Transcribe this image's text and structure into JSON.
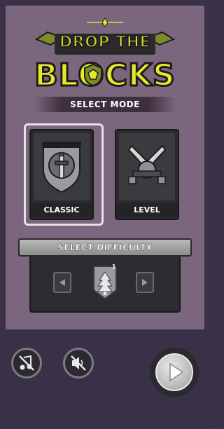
{
  "logo": {
    "line1": "DROP THE",
    "line2": "BLOCKS",
    "colors": {
      "text": "#e4e92b",
      "shield": "#7c8b2a",
      "outline": "#1c1c1c"
    }
  },
  "mode_section": {
    "title": "SELECT MODE",
    "modes": [
      {
        "label": "CLASSIC",
        "icon": "sword-shield-icon",
        "selected": true
      },
      {
        "label": "LEVEL",
        "icon": "crossed-swords-icon",
        "selected": false
      }
    ]
  },
  "difficulty_section": {
    "title": "SELECT DIFFICULTY",
    "current_level_badge": "1",
    "icon": "pine-tree-icon",
    "prev_icon": "arrow-left-icon",
    "next_icon": "arrow-right-icon"
  },
  "controls": {
    "music": {
      "icon": "music-muted-icon"
    },
    "sound": {
      "icon": "sound-muted-icon"
    },
    "play": {
      "icon": "play-icon"
    }
  },
  "colors": {
    "background": "#3a3047",
    "panel": "#7a677d",
    "accent_yellow": "#e4e92b",
    "card_dark": "#2b2b2f"
  }
}
